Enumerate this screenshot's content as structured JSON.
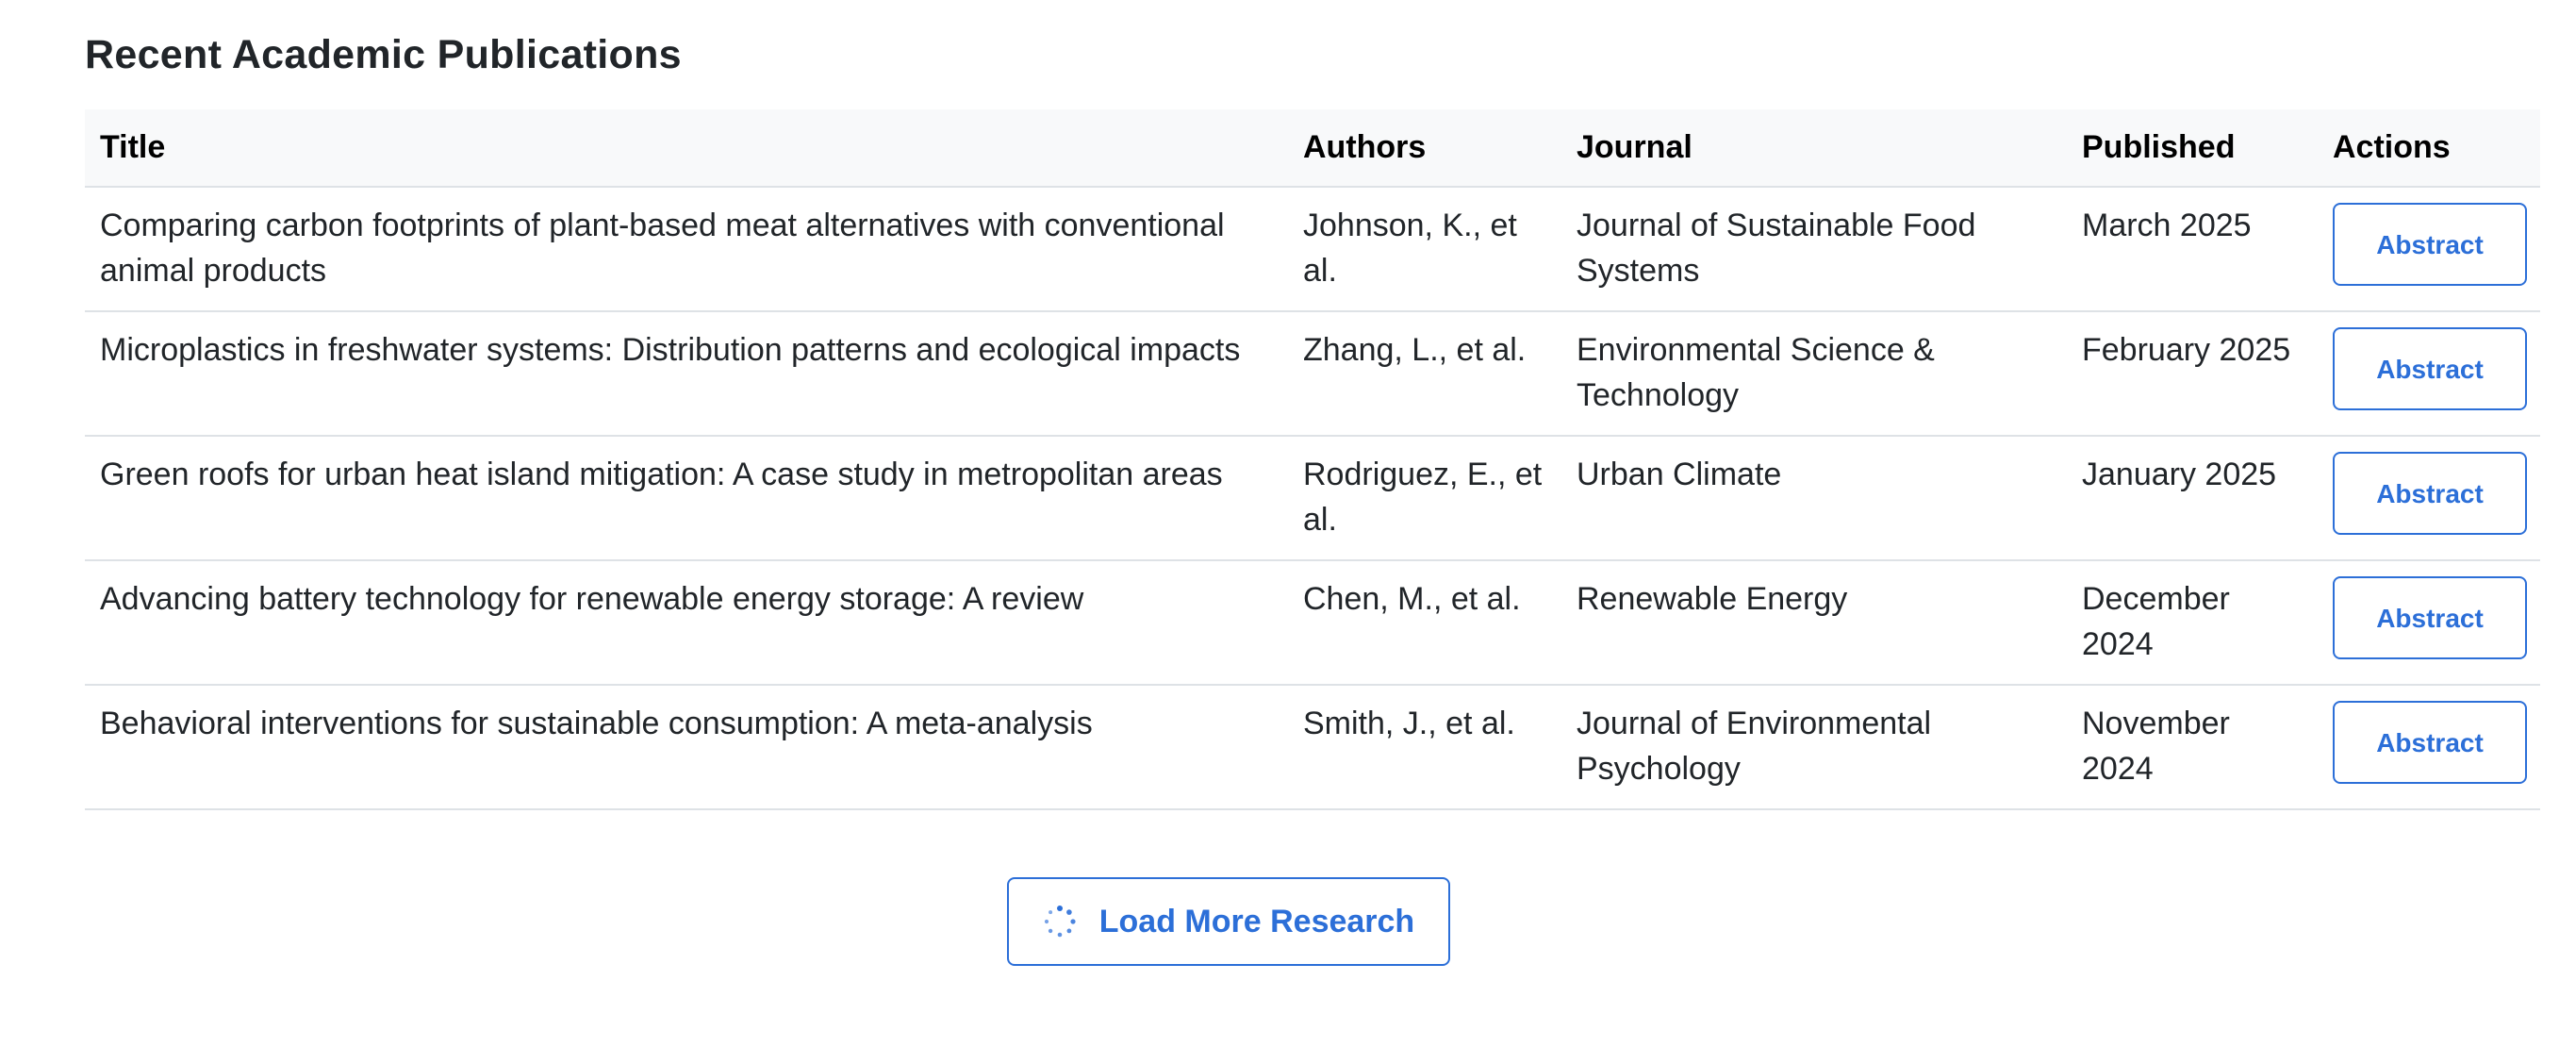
{
  "section": {
    "title": "Recent Academic Publications"
  },
  "table": {
    "headers": {
      "title": "Title",
      "authors": "Authors",
      "journal": "Journal",
      "published": "Published",
      "actions": "Actions"
    },
    "rows": [
      {
        "title": "Comparing carbon footprints of plant-based meat alternatives with conventional animal products",
        "authors": "Johnson, K., et al.",
        "journal": "Journal of Sustainable Food Systems",
        "published": "March 2025",
        "action": "Abstract"
      },
      {
        "title": "Microplastics in freshwater systems: Distribution patterns and ecological impacts",
        "authors": "Zhang, L., et al.",
        "journal": "Environmental Science & Technology",
        "published": "February 2025",
        "action": "Abstract"
      },
      {
        "title": "Green roofs for urban heat island mitigation: A case study in metropolitan areas",
        "authors": "Rodriguez, E., et al.",
        "journal": "Urban Climate",
        "published": "January 2025",
        "action": "Abstract"
      },
      {
        "title": "Advancing battery technology for renewable energy storage: A review",
        "authors": "Chen, M., et al.",
        "journal": "Renewable Energy",
        "published": "December 2024",
        "action": "Abstract"
      },
      {
        "title": "Behavioral interventions for sustainable consumption: A meta-analysis",
        "authors": "Smith, J., et al.",
        "journal": "Journal of Environmental Psychology",
        "published": "November 2024",
        "action": "Abstract"
      }
    ]
  },
  "load_more": {
    "label": "Load More Research",
    "icon": "spinner-icon"
  },
  "colors": {
    "accent": "#2c6fd8",
    "header_bg": "#f8f9fa",
    "border": "#dee2e6",
    "text": "#212529"
  }
}
